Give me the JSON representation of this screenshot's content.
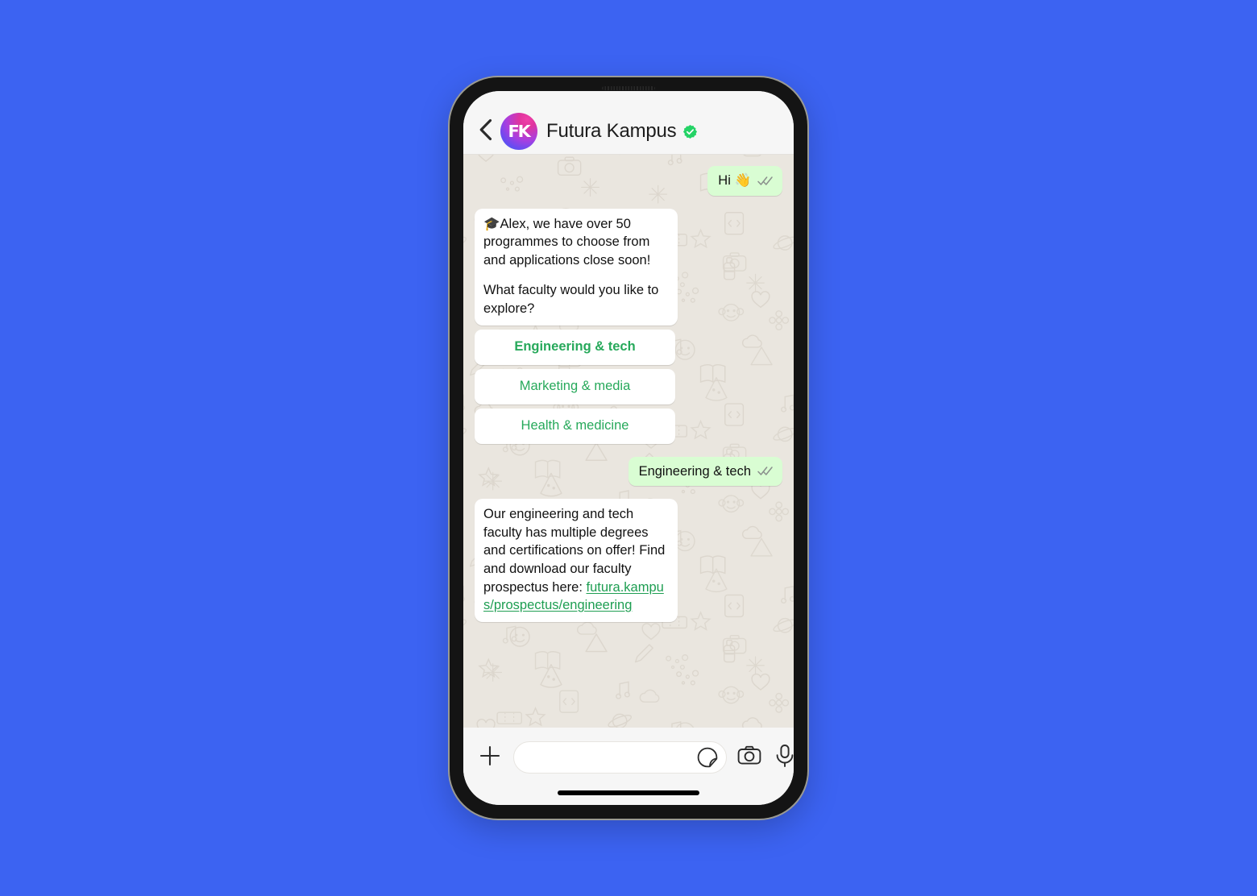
{
  "page": {
    "background_color": "#3C63F2"
  },
  "device": {
    "name": "smartphone-mockup",
    "frame_color": "#141414",
    "speaker_grille": "speaker-grille"
  },
  "header": {
    "back_icon": "chevron-left-icon",
    "avatar": {
      "initials": "FK",
      "gradient_from": "#F03FA8",
      "gradient_to": "#2F6BF0"
    },
    "title": "Futura Kampus",
    "verified": true,
    "verified_icon": "verified-badge-icon",
    "verified_color": "#25D366",
    "background_color": "#F6F6F6"
  },
  "chat": {
    "background_color": "#EAE6DF",
    "outgoing_bubble_color": "#D9FDD3",
    "incoming_bubble_color": "#FFFFFF",
    "link_color": "#1E9E52",
    "accent_green": "#27A95B",
    "messages": [
      {
        "id": "msg-1",
        "direction": "out",
        "text": "Hi 👋",
        "status_icon": "double-check-icon",
        "status": "delivered"
      },
      {
        "id": "msg-2",
        "direction": "in",
        "paragraphs": [
          "🎓Alex, we have over 50 programmes to choose from and applications close soon!",
          "What faculty would you like to explore?"
        ]
      },
      {
        "id": "msg-4",
        "direction": "out",
        "text": "Engineering & tech",
        "status_icon": "double-check-icon",
        "status": "delivered"
      },
      {
        "id": "msg-5",
        "direction": "in",
        "body": "Our engineering and tech faculty has multiple degrees and certifications on offer! Find and download our faculty prospectus here: ",
        "link_text": "futura.kampus/prospectus/engineering"
      }
    ],
    "quick_replies": [
      {
        "label": "Engineering & tech",
        "emphasis": "bold"
      },
      {
        "label": "Marketing & media",
        "emphasis": "regular"
      },
      {
        "label": "Health & medicine",
        "emphasis": "regular"
      }
    ]
  },
  "composer": {
    "background_color": "#F6F6F6",
    "add_icon": "plus-icon",
    "input_value": "",
    "input_placeholder": "",
    "sticker_icon": "sticker-icon",
    "camera_icon": "camera-icon",
    "mic_icon": "microphone-icon"
  }
}
